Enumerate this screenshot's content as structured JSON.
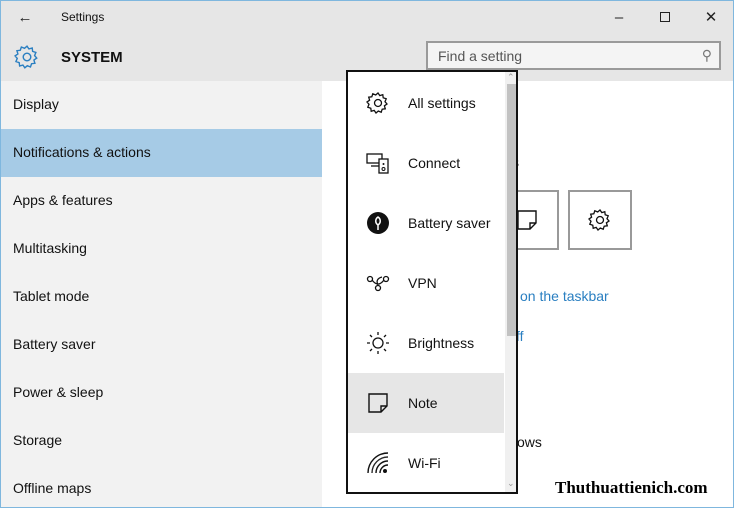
{
  "window": {
    "title": "Settings",
    "section": "SYSTEM",
    "search_placeholder": "Find a setting"
  },
  "sidebar": {
    "items": [
      {
        "label": "Display"
      },
      {
        "label": "Notifications & actions",
        "selected": true
      },
      {
        "label": "Apps & features"
      },
      {
        "label": "Multitasking"
      },
      {
        "label": "Tablet mode"
      },
      {
        "label": "Battery saver"
      },
      {
        "label": "Power & sleep"
      },
      {
        "label": "Storage"
      },
      {
        "label": "Offline maps"
      }
    ]
  },
  "main": {
    "fragments": {
      "heading_tail": "s",
      "link1": "on the taskbar",
      "link2": "ff",
      "text_tail": "ows"
    }
  },
  "dropdown": {
    "items": [
      {
        "label": "All settings",
        "icon": "gear-icon"
      },
      {
        "label": "Connect",
        "icon": "connect-icon"
      },
      {
        "label": "Battery saver",
        "icon": "battery-saver-icon"
      },
      {
        "label": "VPN",
        "icon": "vpn-icon"
      },
      {
        "label": "Brightness",
        "icon": "brightness-icon"
      },
      {
        "label": "Note",
        "icon": "note-icon",
        "highlighted": true
      },
      {
        "label": "Wi-Fi",
        "icon": "wifi-icon"
      }
    ]
  },
  "watermark": "Thuthuattienich.com",
  "colors": {
    "accent": "#2a7fc1",
    "selected": "#a6cbe6"
  }
}
